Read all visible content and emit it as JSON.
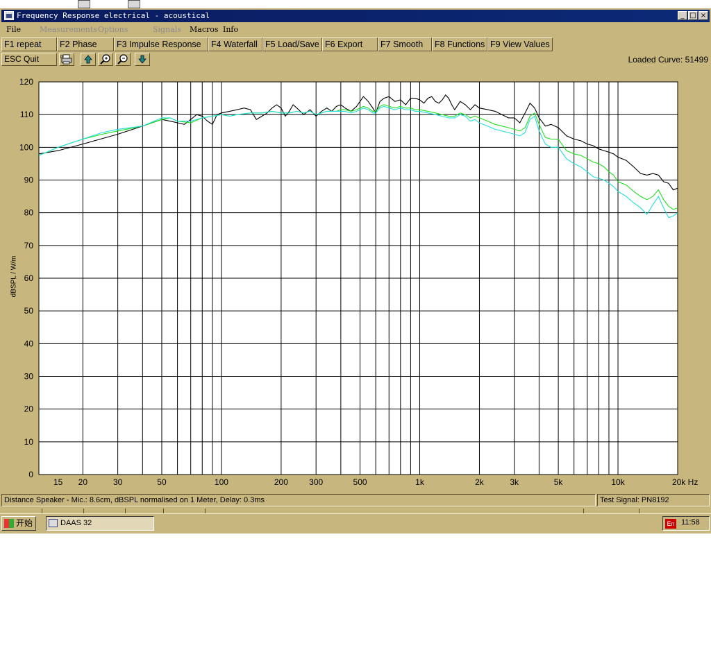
{
  "window": {
    "title": "Frequency Response electrical - acoustical",
    "controls": {
      "minimize": "_",
      "maximize": "□",
      "close": "×"
    }
  },
  "menu": [
    {
      "label": "File",
      "enabled": true
    },
    {
      "label": "Measurements",
      "enabled": false
    },
    {
      "label": "Options",
      "enabled": false
    },
    {
      "label": "Signals",
      "enabled": false
    },
    {
      "label": "Macros",
      "enabled": true
    },
    {
      "label": "Info",
      "enabled": true
    }
  ],
  "function_keys": [
    {
      "key": "F1",
      "label": "repeat"
    },
    {
      "key": "F2",
      "label": "Phase"
    },
    {
      "key": "F3",
      "label": "Impulse Response"
    },
    {
      "key": "F4",
      "label": "Waterfall"
    },
    {
      "key": "F5",
      "label": "Load/Save"
    },
    {
      "key": "F6",
      "label": "Export"
    },
    {
      "key": "F7",
      "label": "Smooth"
    },
    {
      "key": "F8",
      "label": "Functions"
    },
    {
      "key": "F9",
      "label": "View Values"
    }
  ],
  "toolbar": {
    "quit_key": "ESC",
    "quit_label": "Quit",
    "icons": [
      "printer-icon",
      "arrow-up-icon",
      "zoom-in-icon",
      "zoom-out-icon",
      "arrow-down-icon"
    ],
    "loaded_curve": "Loaded Curve: 51499"
  },
  "status": {
    "info": "Distance Speaker - Mic.: 8.6cm, dBSPL normalised on 1 Meter, Delay: 0.3ms",
    "signal": "Test Signal: PN8192"
  },
  "taskbar": {
    "start_label": "开始",
    "task_label": "DAAS 32",
    "lang": "En",
    "time": "11:58"
  },
  "chart_data": {
    "type": "line",
    "ylabel": "dBSPL / W/m",
    "xunit": "Hz",
    "xscale": "log",
    "xlim": [
      12,
      20000
    ],
    "ylim": [
      0,
      120
    ],
    "grid": true,
    "yticks": [
      0,
      10,
      20,
      30,
      40,
      50,
      60,
      70,
      80,
      90,
      100,
      110,
      120
    ],
    "xtick_labels": [
      {
        "v": 15,
        "t": "15"
      },
      {
        "v": 20,
        "t": "20"
      },
      {
        "v": 30,
        "t": "30"
      },
      {
        "v": 50,
        "t": "50"
      },
      {
        "v": 100,
        "t": "100"
      },
      {
        "v": 200,
        "t": "200"
      },
      {
        "v": 300,
        "t": "300"
      },
      {
        "v": 500,
        "t": "500"
      },
      {
        "v": 1000,
        "t": "1k"
      },
      {
        "v": 2000,
        "t": "2k"
      },
      {
        "v": 3000,
        "t": "3k"
      },
      {
        "v": 5000,
        "t": "5k"
      },
      {
        "v": 10000,
        "t": "10k"
      },
      {
        "v": 20000,
        "t": "20k Hz"
      }
    ],
    "series": [
      {
        "color": "#000000",
        "points": [
          [
            12,
            98
          ],
          [
            15,
            99
          ],
          [
            20,
            101
          ],
          [
            30,
            104
          ],
          [
            40,
            106.5
          ],
          [
            50,
            108.5
          ],
          [
            55,
            108
          ],
          [
            60,
            107.5
          ],
          [
            65,
            107
          ],
          [
            70,
            108.5
          ],
          [
            75,
            110
          ],
          [
            80,
            109.5
          ],
          [
            85,
            108
          ],
          [
            90,
            107
          ],
          [
            95,
            110
          ],
          [
            100,
            110.5
          ],
          [
            110,
            111
          ],
          [
            120,
            111.5
          ],
          [
            130,
            112
          ],
          [
            140,
            111.5
          ],
          [
            150,
            108.5
          ],
          [
            160,
            109.5
          ],
          [
            170,
            110.5
          ],
          [
            180,
            112
          ],
          [
            190,
            113
          ],
          [
            200,
            112
          ],
          [
            210,
            109.5
          ],
          [
            220,
            111
          ],
          [
            230,
            113
          ],
          [
            240,
            112
          ],
          [
            260,
            110
          ],
          [
            280,
            111.5
          ],
          [
            300,
            109.5
          ],
          [
            320,
            111
          ],
          [
            340,
            112
          ],
          [
            360,
            111
          ],
          [
            380,
            112.5
          ],
          [
            400,
            113
          ],
          [
            420,
            112
          ],
          [
            450,
            111
          ],
          [
            480,
            112.5
          ],
          [
            500,
            114
          ],
          [
            520,
            115.5
          ],
          [
            550,
            114
          ],
          [
            580,
            112
          ],
          [
            600,
            110.5
          ],
          [
            630,
            114
          ],
          [
            660,
            115
          ],
          [
            700,
            115.5
          ],
          [
            750,
            114
          ],
          [
            800,
            114.5
          ],
          [
            850,
            113
          ],
          [
            900,
            115
          ],
          [
            950,
            115
          ],
          [
            1000,
            114.5
          ],
          [
            1050,
            113.5
          ],
          [
            1100,
            115
          ],
          [
            1150,
            115.5
          ],
          [
            1200,
            114
          ],
          [
            1250,
            113.5
          ],
          [
            1300,
            114.5
          ],
          [
            1350,
            116
          ],
          [
            1400,
            115
          ],
          [
            1450,
            113
          ],
          [
            1500,
            111.5
          ],
          [
            1600,
            114
          ],
          [
            1700,
            113
          ],
          [
            1800,
            111.5
          ],
          [
            1900,
            113
          ],
          [
            2000,
            112
          ],
          [
            2200,
            111.5
          ],
          [
            2400,
            111
          ],
          [
            2600,
            110
          ],
          [
            2800,
            109
          ],
          [
            3000,
            109
          ],
          [
            3200,
            107.5
          ],
          [
            3400,
            110.5
          ],
          [
            3600,
            113.5
          ],
          [
            3800,
            112
          ],
          [
            4000,
            109
          ],
          [
            4300,
            106.5
          ],
          [
            4600,
            107
          ],
          [
            5000,
            106
          ],
          [
            5500,
            103.5
          ],
          [
            6000,
            102.5
          ],
          [
            6500,
            102
          ],
          [
            7000,
            101
          ],
          [
            7500,
            100.5
          ],
          [
            8000,
            99.5
          ],
          [
            8500,
            99
          ],
          [
            9000,
            98.5
          ],
          [
            9500,
            98
          ],
          [
            10000,
            97
          ],
          [
            11000,
            96
          ],
          [
            12000,
            94
          ],
          [
            13000,
            92
          ],
          [
            14000,
            91.5
          ],
          [
            15000,
            92
          ],
          [
            16000,
            91.5
          ],
          [
            17000,
            89.5
          ],
          [
            18000,
            89
          ],
          [
            19000,
            87
          ],
          [
            20000,
            87.5
          ]
        ]
      },
      {
        "color": "#22dd22",
        "points": [
          [
            12,
            97.5
          ],
          [
            15,
            100
          ],
          [
            20,
            102.5
          ],
          [
            25,
            104
          ],
          [
            30,
            105
          ],
          [
            40,
            106.5
          ],
          [
            50,
            108.5
          ],
          [
            55,
            109
          ],
          [
            60,
            108
          ],
          [
            70,
            107.5
          ],
          [
            80,
            109
          ],
          [
            90,
            109.5
          ],
          [
            100,
            110
          ],
          [
            110,
            109.5
          ],
          [
            120,
            110
          ],
          [
            140,
            110.5
          ],
          [
            160,
            110.5
          ],
          [
            180,
            111
          ],
          [
            200,
            110.5
          ],
          [
            220,
            110.5
          ],
          [
            240,
            111
          ],
          [
            260,
            110.5
          ],
          [
            280,
            111
          ],
          [
            300,
            110
          ],
          [
            320,
            110.5
          ],
          [
            340,
            111
          ],
          [
            360,
            111
          ],
          [
            380,
            111
          ],
          [
            400,
            111.5
          ],
          [
            420,
            111.5
          ],
          [
            450,
            111
          ],
          [
            480,
            111.5
          ],
          [
            500,
            112
          ],
          [
            520,
            112.5
          ],
          [
            550,
            112
          ],
          [
            580,
            111
          ],
          [
            600,
            111
          ],
          [
            630,
            112.5
          ],
          [
            660,
            113
          ],
          [
            700,
            112.5
          ],
          [
            750,
            112
          ],
          [
            800,
            112.5
          ],
          [
            850,
            112
          ],
          [
            900,
            112
          ],
          [
            950,
            111.5
          ],
          [
            1000,
            111.5
          ],
          [
            1100,
            111
          ],
          [
            1200,
            110.5
          ],
          [
            1300,
            110
          ],
          [
            1400,
            109.5
          ],
          [
            1500,
            109.5
          ],
          [
            1600,
            110.5
          ],
          [
            1700,
            110
          ],
          [
            1800,
            109
          ],
          [
            1900,
            109.5
          ],
          [
            2000,
            109
          ],
          [
            2200,
            108
          ],
          [
            2400,
            107
          ],
          [
            2600,
            106.5
          ],
          [
            2800,
            106
          ],
          [
            3000,
            105.5
          ],
          [
            3200,
            105
          ],
          [
            3400,
            106
          ],
          [
            3600,
            109.5
          ],
          [
            3800,
            110.5
          ],
          [
            4000,
            107
          ],
          [
            4300,
            103
          ],
          [
            4600,
            102.5
          ],
          [
            5000,
            102.5
          ],
          [
            5500,
            99
          ],
          [
            6000,
            98
          ],
          [
            6500,
            97.5
          ],
          [
            7000,
            96.5
          ],
          [
            7500,
            95.5
          ],
          [
            8000,
            95
          ],
          [
            8500,
            94
          ],
          [
            9000,
            92.5
          ],
          [
            9500,
            91.5
          ],
          [
            10000,
            89.5
          ],
          [
            11000,
            88.5
          ],
          [
            12000,
            86.5
          ],
          [
            13000,
            85
          ],
          [
            14000,
            84
          ],
          [
            15000,
            85
          ],
          [
            16000,
            87
          ],
          [
            17000,
            84
          ],
          [
            18000,
            82
          ],
          [
            19000,
            81
          ],
          [
            20000,
            81.5
          ]
        ]
      },
      {
        "color": "#22dddd",
        "points": [
          [
            12,
            97.5
          ],
          [
            15,
            100
          ],
          [
            20,
            102.5
          ],
          [
            25,
            104.5
          ],
          [
            30,
            105.5
          ],
          [
            40,
            106.5
          ],
          [
            50,
            109
          ],
          [
            55,
            109
          ],
          [
            60,
            108
          ],
          [
            70,
            108
          ],
          [
            80,
            109
          ],
          [
            90,
            109.5
          ],
          [
            100,
            110
          ],
          [
            110,
            109.5
          ],
          [
            120,
            110
          ],
          [
            140,
            110.5
          ],
          [
            160,
            110.5
          ],
          [
            180,
            111
          ],
          [
            200,
            110.5
          ],
          [
            220,
            110.5
          ],
          [
            240,
            111
          ],
          [
            260,
            110.5
          ],
          [
            280,
            111
          ],
          [
            300,
            110
          ],
          [
            320,
            110.5
          ],
          [
            340,
            111
          ],
          [
            360,
            111
          ],
          [
            380,
            111
          ],
          [
            400,
            111
          ],
          [
            420,
            111
          ],
          [
            450,
            110.5
          ],
          [
            480,
            111
          ],
          [
            500,
            111.5
          ],
          [
            520,
            112
          ],
          [
            550,
            111.5
          ],
          [
            580,
            110.5
          ],
          [
            600,
            110.5
          ],
          [
            630,
            112
          ],
          [
            660,
            112.5
          ],
          [
            700,
            112
          ],
          [
            750,
            111.5
          ],
          [
            800,
            112
          ],
          [
            850,
            111.5
          ],
          [
            900,
            111.5
          ],
          [
            950,
            111
          ],
          [
            1000,
            111
          ],
          [
            1100,
            110.5
          ],
          [
            1200,
            110
          ],
          [
            1300,
            109.5
          ],
          [
            1400,
            109
          ],
          [
            1500,
            109
          ],
          [
            1600,
            110
          ],
          [
            1700,
            109.5
          ],
          [
            1800,
            108
          ],
          [
            1900,
            108.5
          ],
          [
            2000,
            107.5
          ],
          [
            2200,
            106.5
          ],
          [
            2400,
            105.5
          ],
          [
            2600,
            105
          ],
          [
            2800,
            104.5
          ],
          [
            3000,
            104
          ],
          [
            3200,
            103.5
          ],
          [
            3400,
            104.5
          ],
          [
            3600,
            108.5
          ],
          [
            3800,
            109.5
          ],
          [
            4000,
            105
          ],
          [
            4300,
            101
          ],
          [
            4600,
            100
          ],
          [
            5000,
            100
          ],
          [
            5500,
            96.5
          ],
          [
            6000,
            95
          ],
          [
            6500,
            94
          ],
          [
            7000,
            92.5
          ],
          [
            7500,
            91
          ],
          [
            8000,
            90.5
          ],
          [
            8500,
            90
          ],
          [
            9000,
            89
          ],
          [
            9500,
            88
          ],
          [
            10000,
            86.5
          ],
          [
            11000,
            85
          ],
          [
            12000,
            83
          ],
          [
            13000,
            81.5
          ],
          [
            14000,
            79.5
          ],
          [
            15000,
            82.5
          ],
          [
            16000,
            85
          ],
          [
            17000,
            81.5
          ],
          [
            18000,
            78.5
          ],
          [
            19000,
            79
          ],
          [
            20000,
            80
          ]
        ]
      }
    ]
  }
}
